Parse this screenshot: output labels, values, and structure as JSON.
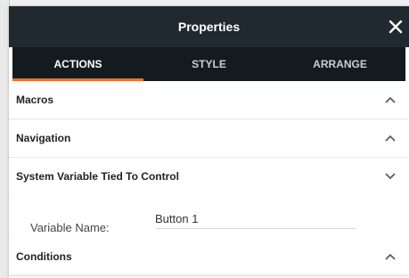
{
  "header": {
    "title": "Properties"
  },
  "tabs": [
    {
      "label": "ACTIONS",
      "active": true
    },
    {
      "label": "STYLE",
      "active": false
    },
    {
      "label": "ARRANGE",
      "active": false
    }
  ],
  "sections": {
    "macros": {
      "label": "Macros",
      "expanded": true
    },
    "navigation": {
      "label": "Navigation",
      "expanded": true
    },
    "system_variable": {
      "label": "System Variable Tied To Control",
      "expanded": false
    },
    "conditions": {
      "label": "Conditions",
      "expanded": true
    }
  },
  "variable": {
    "label": "Variable Name:",
    "value": "Button 1"
  },
  "colors": {
    "header_bg": "#20292f",
    "tabs_bg": "#141b20",
    "accent": "#e8762d"
  }
}
